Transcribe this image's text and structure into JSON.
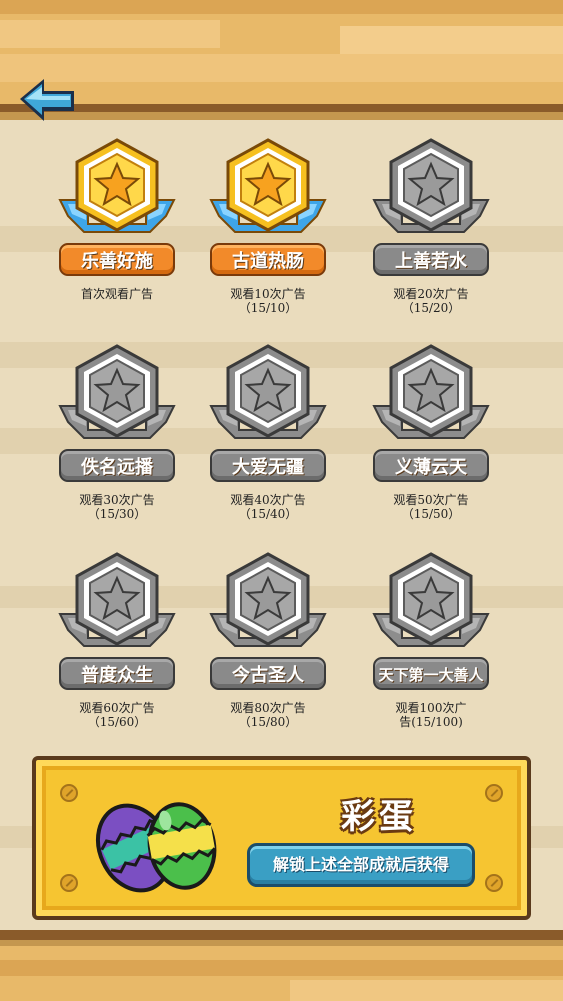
{
  "header": {
    "back_icon": "arrow-left-icon"
  },
  "achievements": [
    {
      "name": "乐善好施",
      "desc_line1": "首次观看广告",
      "desc_line2": "",
      "status": "unlocked"
    },
    {
      "name": "古道热肠",
      "desc_line1": "观看10次广告",
      "desc_line2": "（15/10）",
      "status": "unlocked"
    },
    {
      "name": "上善若水",
      "desc_line1": "观看20次广告",
      "desc_line2": "（15/20）",
      "status": "locked"
    },
    {
      "name": "佚名远播",
      "desc_line1": "观看30次广告",
      "desc_line2": "（15/30）",
      "status": "locked"
    },
    {
      "name": "大爱无疆",
      "desc_line1": "观看40次广告",
      "desc_line2": "（15/40）",
      "status": "locked"
    },
    {
      "name": "义薄云天",
      "desc_line1": "观看50次广告",
      "desc_line2": "（15/50）",
      "status": "locked"
    },
    {
      "name": "普度众生",
      "desc_line1": "观看60次广告",
      "desc_line2": "（15/60）",
      "status": "locked"
    },
    {
      "name": "今古圣人",
      "desc_line1": "观看80次广告",
      "desc_line2": "（15/80）",
      "status": "locked"
    },
    {
      "name": "天下第一大善人",
      "desc_line1": "观看100次广",
      "desc_line2": "告(15/100)",
      "status": "locked"
    }
  ],
  "easter_egg": {
    "title": "彩蛋",
    "unlock_label": "解锁上述全部成就后获得",
    "icon": "easter-eggs-icon"
  },
  "colors": {
    "gold": "#f28a2a",
    "locked": "#8a8a8a",
    "panel": "#f6c531",
    "button": "#3a9fc4"
  }
}
